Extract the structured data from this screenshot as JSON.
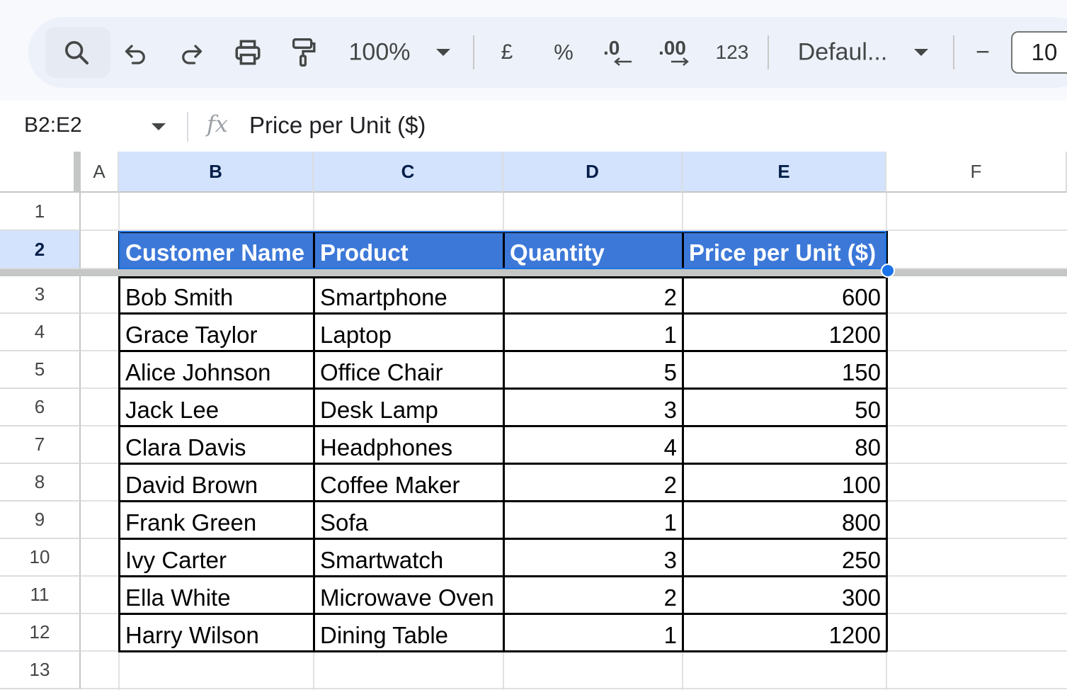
{
  "toolbar": {
    "zoom": "100%",
    "currency": "£",
    "percent": "%",
    "decrease_decimal": ".0",
    "increase_decimal": ".00",
    "number_format": "123",
    "font": "Defaul...",
    "minus": "−",
    "font_size": "10"
  },
  "formula_bar": {
    "name_box": "B2:E2",
    "fx": "fx",
    "content": "Price per Unit ($)"
  },
  "columns": [
    "A",
    "B",
    "C",
    "D",
    "E",
    "F"
  ],
  "rows": [
    "1",
    "2",
    "3",
    "4",
    "5",
    "6",
    "7",
    "8",
    "9",
    "10",
    "11",
    "12",
    "13"
  ],
  "table": {
    "headers": [
      "Customer Name",
      "Product",
      "Quantity",
      "Price per Unit ($)"
    ],
    "rows": [
      {
        "name": "Bob Smith",
        "product": "Smartphone",
        "qty": "2",
        "price": "600"
      },
      {
        "name": "Grace Taylor",
        "product": "Laptop",
        "qty": "1",
        "price": "1200"
      },
      {
        "name": "Alice Johnson",
        "product": "Office Chair",
        "qty": "5",
        "price": "150"
      },
      {
        "name": "Jack Lee",
        "product": "Desk Lamp",
        "qty": "3",
        "price": "50"
      },
      {
        "name": "Clara Davis",
        "product": "Headphones",
        "qty": "4",
        "price": "80"
      },
      {
        "name": "David Brown",
        "product": "Coffee Maker",
        "qty": "2",
        "price": "100"
      },
      {
        "name": "Frank Green",
        "product": "Sofa",
        "qty": "1",
        "price": "800"
      },
      {
        "name": "Ivy Carter",
        "product": "Smartwatch",
        "qty": "3",
        "price": "250"
      },
      {
        "name": "Ella White",
        "product": "Microwave Oven",
        "qty": "2",
        "price": "300"
      },
      {
        "name": "Harry Wilson",
        "product": "Dining Table",
        "qty": "1",
        "price": "1200"
      }
    ]
  },
  "colors": {
    "header_fill": "#3c78d8",
    "selection": "#1a73e8",
    "selected_header": "#d3e3fd"
  }
}
